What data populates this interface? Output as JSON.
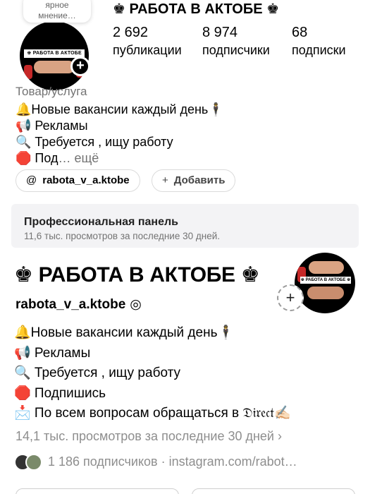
{
  "instagram": {
    "note_text": "ярное\nмнение…",
    "name": "♚ РАБОТА В АКТОБЕ ♚",
    "avatar_banner": "♚ РАБОТА В АКТОБЕ ♚",
    "stats": [
      {
        "value": "2 692",
        "label": "публикации"
      },
      {
        "value": "8 974",
        "label": "подписчики"
      },
      {
        "value": "68",
        "label": "подписки"
      }
    ],
    "category": "Товар/услуга",
    "bio": [
      "🔔Новые вакансии каждый день🕴",
      "📢 Рекламы",
      "🔍 Требуется , ищу работу"
    ],
    "bio_last_prefix": "🛑 Под",
    "bio_more": "… ещё",
    "threads_chip": {
      "icon": "@",
      "label": "rabota_v_a.ktobe"
    },
    "add_chip": {
      "icon": "+",
      "label": "Добавить"
    },
    "pro_panel": {
      "title": "Профессиональная панель",
      "subtitle": "11,6 тыс. просмотров за последние 30 дней."
    }
  },
  "threads": {
    "name": "♚ РАБОТА В АКТОБЕ ♚",
    "handle": "rabota_v_a.ktobe",
    "handle_icon": "◎",
    "avatar_banner": "♚ РАБОТА В АКТОБЕ ♚",
    "bio": [
      "🔔Новые вакансии каждый день🕴",
      "📢 Рекламы",
      "🔍 Требуется , ищу работу",
      "🛑 Подпишись",
      "📩 По всем вопросам обращаться в 𝔇𝔦𝔯𝔢𝔠𝔱✍🏻"
    ],
    "views": "14,1 тыс. просмотров за последние 30 дней  ›",
    "followers": "1 186 подписчиков  ·  instagram.com/rabot…",
    "plus_icon": "+"
  }
}
